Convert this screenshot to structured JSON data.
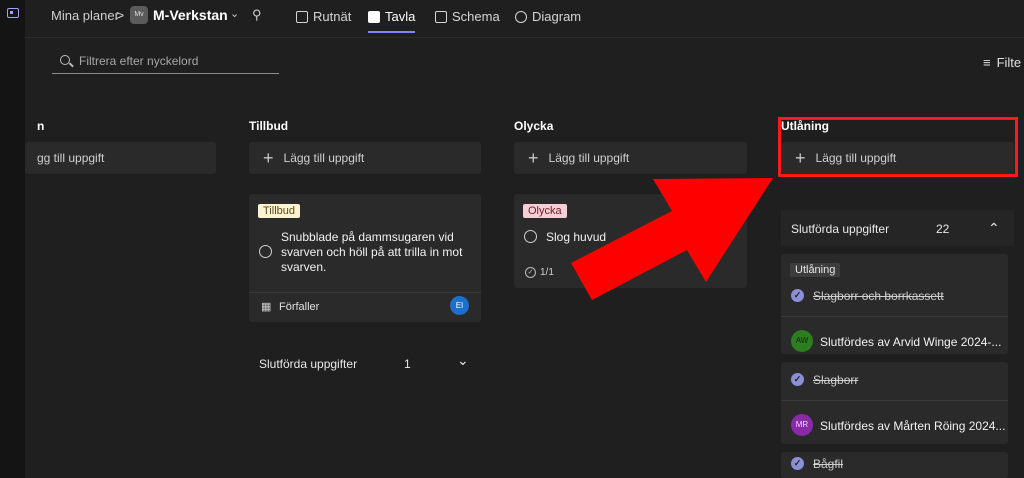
{
  "breadcrumb": {
    "root": "Mina planer",
    "separator": ">",
    "plan_icon_text": "Mv",
    "plan_title": "M-Verkstan",
    "chevron": "⌄",
    "pin": "⚲"
  },
  "tabs": [
    {
      "label": "Rutnät"
    },
    {
      "label": "Tavla"
    },
    {
      "label": "Schema"
    },
    {
      "label": "Diagram"
    }
  ],
  "filter": {
    "placeholder": "Filtrera efter nyckelord",
    "button_label": "Filte",
    "button_icon": "≡"
  },
  "columns": [
    {
      "title": "n",
      "add_label": "gg till uppgift"
    },
    {
      "title": "Tillbud",
      "add_label": "Lägg till uppgift"
    },
    {
      "title": "Olycka",
      "add_label": "Lägg till uppgift"
    },
    {
      "title": "Utlåning",
      "add_label": "Lägg till uppgift"
    }
  ],
  "cards": {
    "tillbud": {
      "label": "Tillbud",
      "text_line1": "Snubblade på dammsugaren vid",
      "text_line2": "svarven och höll på att trilla in mot",
      "text_line3": "svarven.",
      "due_label": "Förfaller",
      "due_icon": "▦",
      "avatar": "EI"
    },
    "olycka": {
      "label": "Olycka",
      "text": "Slog huvud",
      "checklist_icon": "✓",
      "checklist": "1/1"
    }
  },
  "tillbud_completed": {
    "label": "Slutförda uppgifter",
    "count": "1",
    "chevron": "⌄"
  },
  "utlaning_completed": {
    "label": "Slutförda uppgifter",
    "count": "22",
    "chevron": "⌃",
    "items": [
      {
        "label": "Utlåning",
        "title": "Slagborr och borrkassett"
      },
      {
        "avatar": "AW",
        "done_by": "Slutfördes av Arvid Winge 2024-..."
      },
      {
        "title": "Slagborr"
      },
      {
        "avatar": "MR",
        "done_by": "Slutfördes av Mårten Röing 2024..."
      },
      {
        "title": "Bågfil"
      }
    ]
  },
  "colors": {
    "accent": "#7f85f5",
    "highlight": "#ff1a1a",
    "tillbud_chip": "#fbf3d2",
    "olycka_chip": "#f5cfd5",
    "avatar_ei": "#1d6fce",
    "avatar_aw": "#2e7d1f",
    "avatar_mr": "#8a2aa8"
  }
}
